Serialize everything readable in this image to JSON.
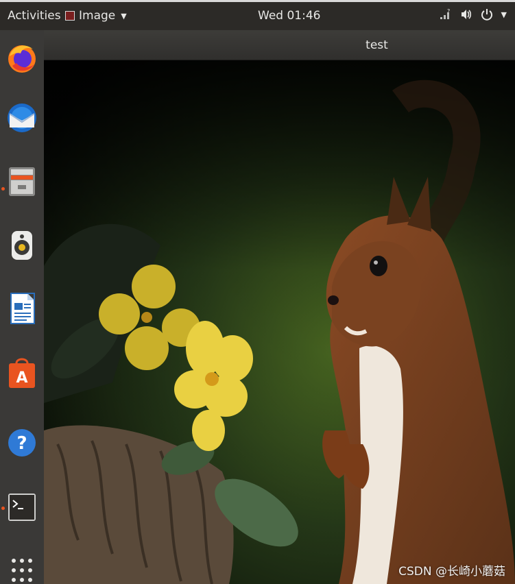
{
  "topbar": {
    "activities": "Activities",
    "app_menu": "Image",
    "clock": "Wed 01:46",
    "tray": [
      "network-icon",
      "volume-icon",
      "power-icon"
    ]
  },
  "dock": {
    "items": [
      {
        "name": "firefox-icon",
        "running": false
      },
      {
        "name": "thunderbird-icon",
        "running": false
      },
      {
        "name": "files-icon",
        "running": true
      },
      {
        "name": "rhythmbox-icon",
        "running": false
      },
      {
        "name": "libreoffice-writer-icon",
        "running": false
      },
      {
        "name": "software-center-icon",
        "running": false
      },
      {
        "name": "help-icon",
        "running": false
      },
      {
        "name": "terminal-icon",
        "running": true
      },
      {
        "name": "show-applications-icon",
        "running": false
      }
    ]
  },
  "window": {
    "title": "test",
    "image_subject": "squirrel with yellow primrose flowers and basket"
  },
  "watermark": "CSDN @长崎小蘑菇",
  "colors": {
    "accent": "#e95420",
    "topbar": "#2c2a27",
    "dock": "#3a3937"
  }
}
